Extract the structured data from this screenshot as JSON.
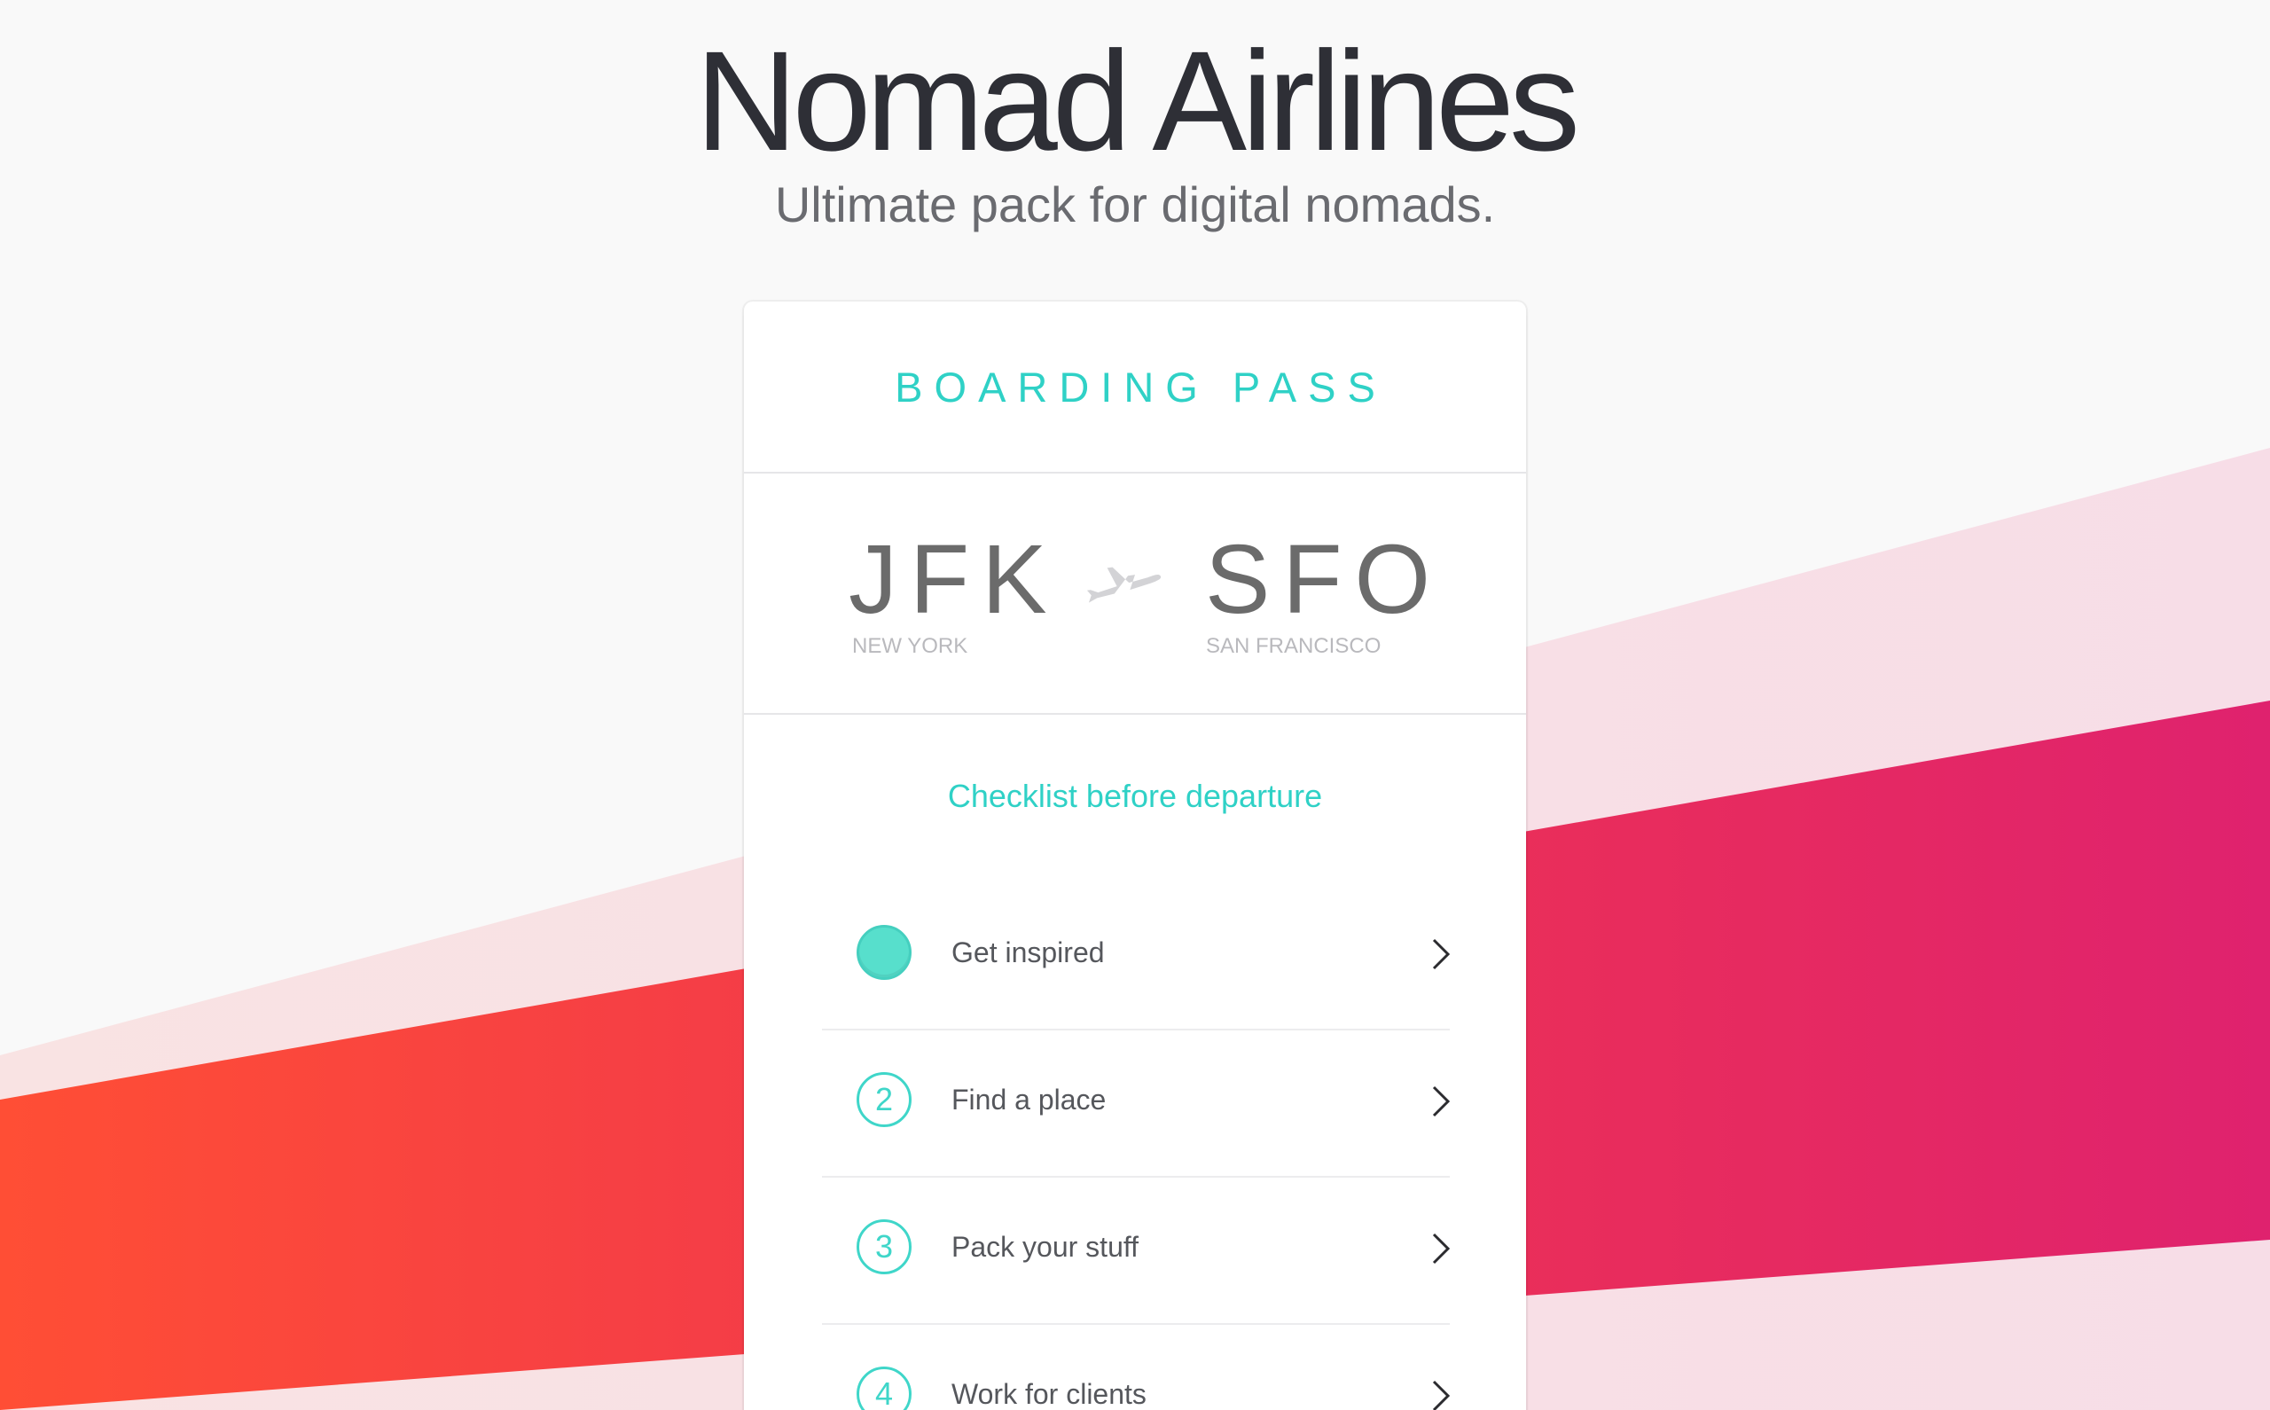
{
  "header": {
    "title": "Nomad Airlines",
    "subtitle": "Ultimate pack for digital nomads."
  },
  "card": {
    "heading": "BOARDING PASS",
    "from": {
      "code": "JFK",
      "city": "NEW YORK"
    },
    "to": {
      "code": "SFO",
      "city": "SAN FRANCISCO"
    },
    "checklist_title": "Checklist before departure",
    "items": [
      {
        "step": "",
        "label": "Get inspired",
        "done": true
      },
      {
        "step": "2",
        "label": "Find a place",
        "done": false
      },
      {
        "step": "3",
        "label": "Pack your stuff",
        "done": false
      },
      {
        "step": "4",
        "label": "Work for clients",
        "done": false
      }
    ]
  },
  "colors": {
    "accent": "#2fd1c6",
    "title": "#2e2f36",
    "band_pink_light": "#f7dde6",
    "band_peach_light": "#f9e2e2",
    "band_red_start": "#ff4f37",
    "band_red_end": "#e0216c"
  }
}
